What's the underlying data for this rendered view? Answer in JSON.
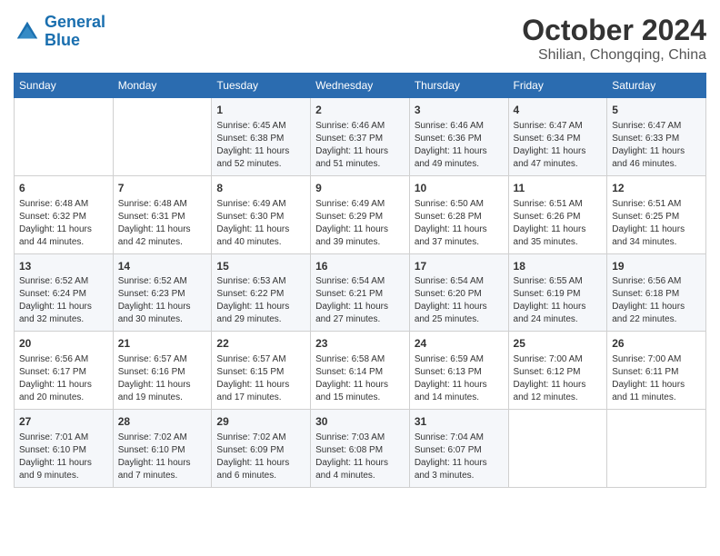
{
  "header": {
    "logo_line1": "General",
    "logo_line2": "Blue",
    "month": "October 2024",
    "location": "Shilian, Chongqing, China"
  },
  "weekdays": [
    "Sunday",
    "Monday",
    "Tuesday",
    "Wednesday",
    "Thursday",
    "Friday",
    "Saturday"
  ],
  "weeks": [
    [
      {
        "day": "",
        "info": ""
      },
      {
        "day": "",
        "info": ""
      },
      {
        "day": "1",
        "info": "Sunrise: 6:45 AM\nSunset: 6:38 PM\nDaylight: 11 hours and 52 minutes."
      },
      {
        "day": "2",
        "info": "Sunrise: 6:46 AM\nSunset: 6:37 PM\nDaylight: 11 hours and 51 minutes."
      },
      {
        "day": "3",
        "info": "Sunrise: 6:46 AM\nSunset: 6:36 PM\nDaylight: 11 hours and 49 minutes."
      },
      {
        "day": "4",
        "info": "Sunrise: 6:47 AM\nSunset: 6:34 PM\nDaylight: 11 hours and 47 minutes."
      },
      {
        "day": "5",
        "info": "Sunrise: 6:47 AM\nSunset: 6:33 PM\nDaylight: 11 hours and 46 minutes."
      }
    ],
    [
      {
        "day": "6",
        "info": "Sunrise: 6:48 AM\nSunset: 6:32 PM\nDaylight: 11 hours and 44 minutes."
      },
      {
        "day": "7",
        "info": "Sunrise: 6:48 AM\nSunset: 6:31 PM\nDaylight: 11 hours and 42 minutes."
      },
      {
        "day": "8",
        "info": "Sunrise: 6:49 AM\nSunset: 6:30 PM\nDaylight: 11 hours and 40 minutes."
      },
      {
        "day": "9",
        "info": "Sunrise: 6:49 AM\nSunset: 6:29 PM\nDaylight: 11 hours and 39 minutes."
      },
      {
        "day": "10",
        "info": "Sunrise: 6:50 AM\nSunset: 6:28 PM\nDaylight: 11 hours and 37 minutes."
      },
      {
        "day": "11",
        "info": "Sunrise: 6:51 AM\nSunset: 6:26 PM\nDaylight: 11 hours and 35 minutes."
      },
      {
        "day": "12",
        "info": "Sunrise: 6:51 AM\nSunset: 6:25 PM\nDaylight: 11 hours and 34 minutes."
      }
    ],
    [
      {
        "day": "13",
        "info": "Sunrise: 6:52 AM\nSunset: 6:24 PM\nDaylight: 11 hours and 32 minutes."
      },
      {
        "day": "14",
        "info": "Sunrise: 6:52 AM\nSunset: 6:23 PM\nDaylight: 11 hours and 30 minutes."
      },
      {
        "day": "15",
        "info": "Sunrise: 6:53 AM\nSunset: 6:22 PM\nDaylight: 11 hours and 29 minutes."
      },
      {
        "day": "16",
        "info": "Sunrise: 6:54 AM\nSunset: 6:21 PM\nDaylight: 11 hours and 27 minutes."
      },
      {
        "day": "17",
        "info": "Sunrise: 6:54 AM\nSunset: 6:20 PM\nDaylight: 11 hours and 25 minutes."
      },
      {
        "day": "18",
        "info": "Sunrise: 6:55 AM\nSunset: 6:19 PM\nDaylight: 11 hours and 24 minutes."
      },
      {
        "day": "19",
        "info": "Sunrise: 6:56 AM\nSunset: 6:18 PM\nDaylight: 11 hours and 22 minutes."
      }
    ],
    [
      {
        "day": "20",
        "info": "Sunrise: 6:56 AM\nSunset: 6:17 PM\nDaylight: 11 hours and 20 minutes."
      },
      {
        "day": "21",
        "info": "Sunrise: 6:57 AM\nSunset: 6:16 PM\nDaylight: 11 hours and 19 minutes."
      },
      {
        "day": "22",
        "info": "Sunrise: 6:57 AM\nSunset: 6:15 PM\nDaylight: 11 hours and 17 minutes."
      },
      {
        "day": "23",
        "info": "Sunrise: 6:58 AM\nSunset: 6:14 PM\nDaylight: 11 hours and 15 minutes."
      },
      {
        "day": "24",
        "info": "Sunrise: 6:59 AM\nSunset: 6:13 PM\nDaylight: 11 hours and 14 minutes."
      },
      {
        "day": "25",
        "info": "Sunrise: 7:00 AM\nSunset: 6:12 PM\nDaylight: 11 hours and 12 minutes."
      },
      {
        "day": "26",
        "info": "Sunrise: 7:00 AM\nSunset: 6:11 PM\nDaylight: 11 hours and 11 minutes."
      }
    ],
    [
      {
        "day": "27",
        "info": "Sunrise: 7:01 AM\nSunset: 6:10 PM\nDaylight: 11 hours and 9 minutes."
      },
      {
        "day": "28",
        "info": "Sunrise: 7:02 AM\nSunset: 6:10 PM\nDaylight: 11 hours and 7 minutes."
      },
      {
        "day": "29",
        "info": "Sunrise: 7:02 AM\nSunset: 6:09 PM\nDaylight: 11 hours and 6 minutes."
      },
      {
        "day": "30",
        "info": "Sunrise: 7:03 AM\nSunset: 6:08 PM\nDaylight: 11 hours and 4 minutes."
      },
      {
        "day": "31",
        "info": "Sunrise: 7:04 AM\nSunset: 6:07 PM\nDaylight: 11 hours and 3 minutes."
      },
      {
        "day": "",
        "info": ""
      },
      {
        "day": "",
        "info": ""
      }
    ]
  ]
}
